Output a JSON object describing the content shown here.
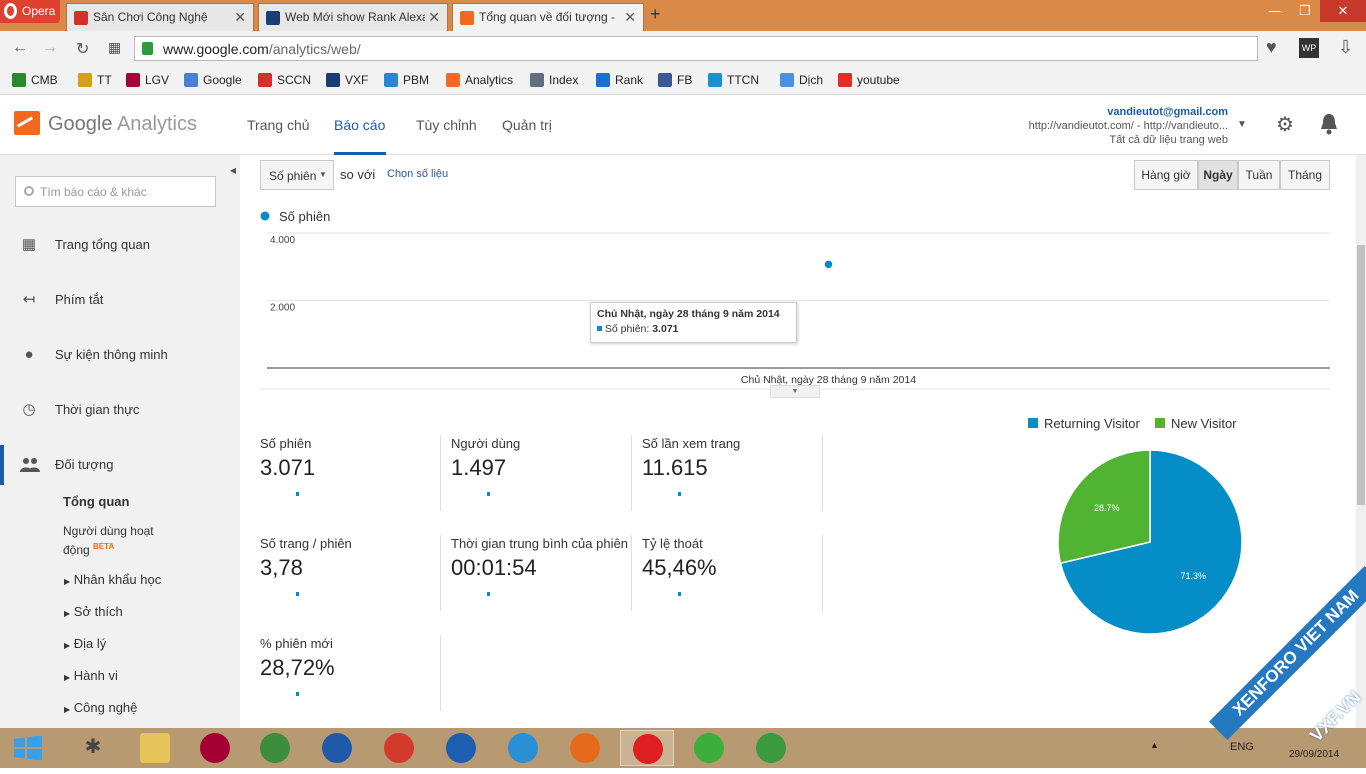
{
  "browser": {
    "opera_label": "Opera",
    "tabs": [
      {
        "label": "Sân Chơi Công Nghệ",
        "icon": "xf-icon",
        "color": "#d3302a"
      },
      {
        "label": "Web Mới show Rank Alexa",
        "icon": "vxf-icon",
        "color": "#1b3d75"
      },
      {
        "label": "Tổng quan về đối tượng -",
        "icon": "analytics-icon",
        "color": "#f4691f"
      }
    ],
    "close_glyph": "✕",
    "newtab_glyph": "+",
    "url_domain": "www.google.com",
    "url_path": "/analytics/web/",
    "bookmarks": [
      {
        "label": "CMB",
        "color": "#2a8a2a"
      },
      {
        "label": "TT",
        "color": "#d4a017"
      },
      {
        "label": "LGV",
        "color": "#a50034"
      },
      {
        "label": "Google",
        "color": "#4a7fd4"
      },
      {
        "label": "SCCN",
        "color": "#d3302a"
      },
      {
        "label": "VXF",
        "color": "#1b3d75"
      },
      {
        "label": "PBM",
        "color": "#2a86d4"
      },
      {
        "label": "Analytics",
        "color": "#f4691f"
      },
      {
        "label": "Index",
        "color": "#607080"
      },
      {
        "label": "Rank",
        "color": "#1a6fd0"
      },
      {
        "label": "FB",
        "color": "#3b5998"
      },
      {
        "label": "TTCN",
        "color": "#1a8fd0"
      },
      {
        "label": "Dịch",
        "color": "#4a90e2"
      },
      {
        "label": "youtube",
        "color": "#e52d27"
      }
    ]
  },
  "ga": {
    "logo_google": "Google",
    "logo_analytics": "Analytics",
    "nav": [
      "Trang chủ",
      "Báo cáo",
      "Tùy chỉnh",
      "Quản trị"
    ],
    "account_email": "vandieutot@gmail.com",
    "account_property": "http://vandieutot.com/ - http://vandieuto...",
    "account_view": "Tất cả dữ liệu trang web"
  },
  "sidebar": {
    "search_placeholder": "Tìm báo cáo & khác",
    "items": [
      {
        "label": "Trang tổng quan",
        "icon": "dashboard-grid-icon"
      },
      {
        "label": "Phím tắt",
        "icon": "shortcut-arrow-icon"
      },
      {
        "label": "Sự kiện thông minh",
        "icon": "lightbulb-icon"
      },
      {
        "label": "Thời gian thực",
        "icon": "clock-icon"
      },
      {
        "label": "Đối tượng",
        "icon": "people-icon"
      }
    ],
    "sub_active": "Tổng quan",
    "sub_active_users": "Người dùng hoạt",
    "sub_active_users2": "động",
    "beta": "BETA",
    "sub_items": [
      "Nhân khẩu học",
      "Sở thích",
      "Địa lý",
      "Hành vi",
      "Công nghệ"
    ]
  },
  "main": {
    "metric_select": "Số phiên",
    "compare_text": "so với",
    "choose_metric": "Chọn số liệu",
    "granularity": [
      "Hàng giờ",
      "Ngày",
      "Tuần",
      "Tháng"
    ],
    "selected_granularity": "Ngày",
    "tooltip_title": "Chủ Nhật, ngày 28 tháng 9 năm 2014",
    "tooltip_label": "Số phiên:",
    "tooltip_value": "3.071",
    "metrics": [
      {
        "label": "Số phiên",
        "value": "3.071"
      },
      {
        "label": "Người dùng",
        "value": "1.497"
      },
      {
        "label": "Số lần xem trang",
        "value": "11.615"
      },
      {
        "label": "Số trang / phiên",
        "value": "3,78"
      },
      {
        "label": "Thời gian trung bình của phiên",
        "value": "00:01:54"
      },
      {
        "label": "Tỷ lệ thoát",
        "value": "45,46%"
      },
      {
        "label": "% phiên mới",
        "value": "28,72%"
      }
    ]
  },
  "chart_data": [
    {
      "type": "line",
      "x": [
        "Chủ Nhật, ngày 28 tháng 9 năm 2014"
      ],
      "series": [
        {
          "name": "Số phiên",
          "values": [
            3071
          ],
          "color": "#058dc7"
        }
      ],
      "yticks": [
        "4.000",
        "2.000"
      ],
      "ylim": [
        0,
        4000
      ],
      "grid": true,
      "legend": "top-left"
    },
    {
      "type": "pie",
      "categories": [
        "Returning Visitor",
        "New Visitor"
      ],
      "values": [
        71.3,
        28.7
      ],
      "labels": [
        "71.3%",
        "28.7%"
      ],
      "colors": [
        "#058dc7",
        "#50b432"
      ],
      "legend": "top"
    }
  ],
  "taskbar": {
    "apps": [
      {
        "name": "file-explorer-icon",
        "color": "#e7c45a"
      },
      {
        "name": "lg-icon",
        "color": "#a50034"
      },
      {
        "name": "office-icon",
        "color": "#3c8d3c"
      },
      {
        "name": "vietkey-icon",
        "color": "#1e5aa8"
      },
      {
        "name": "ccleaner-icon",
        "color": "#d33a2c"
      },
      {
        "name": "maxthon-icon",
        "color": "#1c5fb0"
      },
      {
        "name": "ie-icon",
        "color": "#2b8fd8"
      },
      {
        "name": "firefox-icon",
        "color": "#e76a1c"
      },
      {
        "name": "opera-icon",
        "color": "#e02020"
      },
      {
        "name": "coccoc-icon",
        "color": "#3cae3c"
      },
      {
        "name": "chrome-icon",
        "color": "#3b9a3b"
      }
    ],
    "lang": "ENG",
    "date": "29/09/2014"
  },
  "watermark": {
    "line1": "XENFORO VIET NAM",
    "line2": "VXF.VN"
  }
}
